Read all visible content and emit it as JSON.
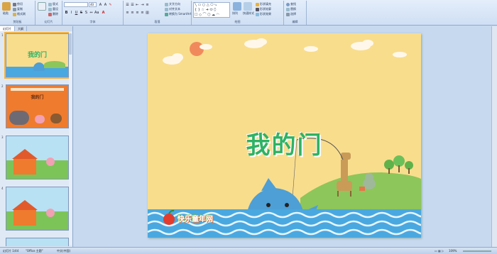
{
  "ribbon": {
    "groups": [
      {
        "label": "剪贴板"
      },
      {
        "label": "幻灯片"
      },
      {
        "label": "字体"
      },
      {
        "label": "段落"
      },
      {
        "label": "绘图"
      },
      {
        "label": "编辑"
      }
    ],
    "clipboard": {
      "paste": "粘贴",
      "cut": "剪切",
      "copy": "复制",
      "format_painter": "格式刷"
    },
    "slides": {
      "new_slide": "新建幻灯片",
      "layout": "版式",
      "reset": "重设",
      "delete": "删除"
    },
    "font": {
      "font_name": "",
      "font_size": "40"
    },
    "paragraph": {
      "text_direction": "文字方向",
      "align_text": "对齐文本",
      "smartart": "转换为 SmartArt"
    },
    "drawing": {
      "arrange": "排列",
      "quick_styles": "快速样式",
      "fill": "形状填充",
      "outline": "形状轮廓",
      "effects": "形状效果"
    },
    "editing": {
      "find": "查找",
      "replace": "替换",
      "select": "选择"
    }
  },
  "panel": {
    "tabs": [
      "幻灯片",
      "大纲"
    ],
    "thumbs": [
      {
        "num": "1",
        "title": "我的门"
      },
      {
        "num": "2",
        "title": "我的门"
      },
      {
        "num": "3",
        "title": ""
      },
      {
        "num": "4",
        "title": ""
      }
    ]
  },
  "slide": {
    "title": "我的门",
    "logo_text": "快乐童年网"
  },
  "status": {
    "slide_info": "幻灯片 1/44",
    "theme": "\"Office 主题\"",
    "language": "中文(中国)",
    "zoom": "109%"
  },
  "colors": {
    "slide_bg": "#f8dd8d",
    "title_green": "#2eb264",
    "water_blue": "#4aa8e0"
  }
}
